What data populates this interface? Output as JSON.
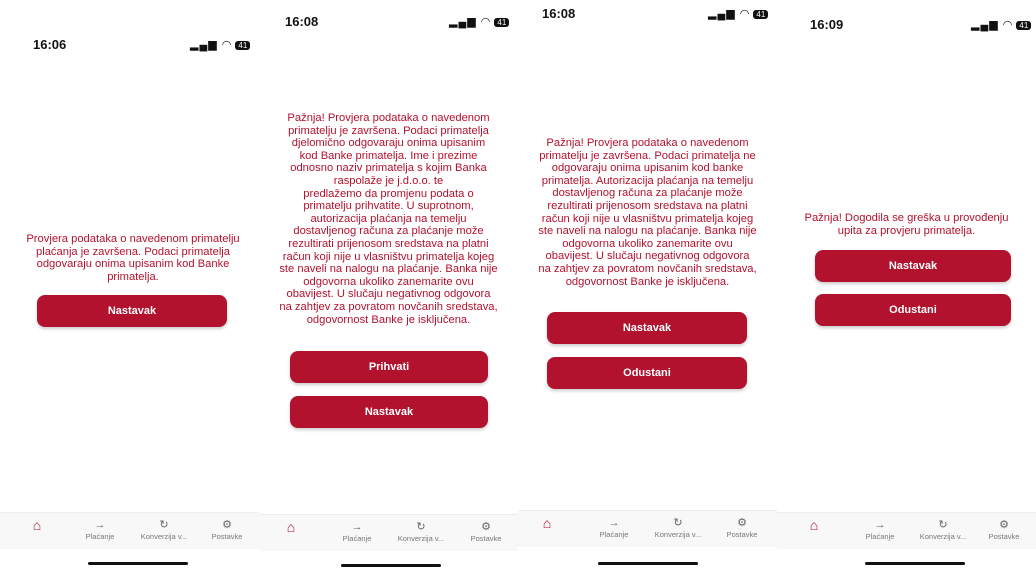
{
  "tabs": {
    "payments_label": "Plaćanje",
    "conversion_label": "Konverzija v...",
    "settings_label": "Postavke",
    "home_icon": "home-icon",
    "payments_icon": "arrow-right-icon",
    "conversion_icon": "refresh-icon",
    "settings_icon": "gear-icon"
  },
  "status_bar": {
    "battery": "41",
    "signal_icons": "signal-wifi-icons"
  },
  "colors": {
    "accent": "#b2122d",
    "text_red": "#b3122e"
  },
  "screens": [
    {
      "time": "16:06",
      "message": "Provjera podataka o navedenom primatelju\nplaćanja je završena. Podaci primatelja\nodgovaraju onima upisanim kod Banke\nprimatelja.",
      "buttons": [
        "Nastavak"
      ]
    },
    {
      "time": "16:08",
      "message": "Pažnja! Provjera podataka o navedenom\nprimatelju je završena. Podaci primatelja\ndjelomično odgovaraju onima upisanim\nkod Banke primatelja. Ime i prezime\nodnosno naziv primatelja s kojim  Banka\nraspolaže je                     j.d.o.o. te\npredlažemo da promjenu podata o\nprimatelju prihvatite. U suprotnom,\nautorizacija plaćanja na temelju\ndostavljenog računa za plaćanje može\nrezultirati prijenosom sredstava na platni\nračun koji nije u vlasništvu primatelja kojeg\nste naveli na nalogu na plaćanje. Banka nije\nodgovorna ukoliko zanemarite ovu\nobavijest. U slučaju negativnog odgovora\nna zahtjev za povratom novčanih sredstava,\nodgovornost Banke je isključena.",
      "buttons": [
        "Prihvati",
        "Nastavak"
      ]
    },
    {
      "time": "16:08",
      "message": "Pažnja! Provjera podataka o navedenom\nprimatelju je završena. Podaci primatelja ne\nodgovaraju onima upisanim kod banke\nprimatelja. Autorizacija plaćanja na temelju\ndostavljenog računa za plaćanje može\nrezultirati prijenosom sredstava na platni\nračun koji nije u vlasništvu primatelja kojeg\nste naveli na nalogu na plaćanje. Banka nije\nodgovorna ukoliko zanemarite ovu\nobavijest. U slučaju negativnog odgovora\nna zahtjev za povratom novčanih sredstava,\nodgovornost Banke je isključena.",
      "buttons": [
        "Nastavak",
        "Odustani"
      ]
    },
    {
      "time": "16:09",
      "message": "Pažnja! Dogodila se greška u provođenju\nupita za provjeru primatelja.",
      "buttons": [
        "Nastavak",
        "Odustani"
      ]
    }
  ]
}
